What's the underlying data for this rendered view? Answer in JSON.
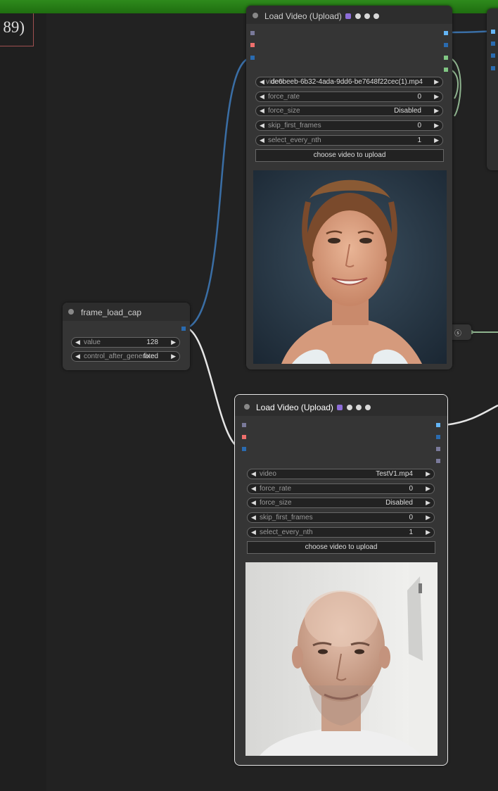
{
  "canvas": {
    "corner_label": "89)"
  },
  "colors": {
    "background": "#222222",
    "node_body": "#353535",
    "node_header": "#2d2d2d",
    "wire_blue": "#3a6ea5",
    "wire_white": "#e6e6e6",
    "wire_green": "#8fb48f",
    "port_image": "#64b5f6",
    "port_mask": "#81c784",
    "port_audio": "#ef6f6c",
    "port_int": "#2a6bb0",
    "port_meta": "#7a7a9a"
  },
  "frame_load_cap_node": {
    "title": "frame_load_cap",
    "widgets": [
      {
        "label": "value",
        "value": "128"
      },
      {
        "label": "control_after_generate",
        "value": "fixed"
      }
    ]
  },
  "load_video_top": {
    "title": "Load Video (Upload)",
    "badges": [
      "purple-badge-icon",
      "v-badge-icon",
      "h-badge-icon",
      "s-badge-icon"
    ],
    "widgets": [
      {
        "label": "video",
        "value": "de6beeb-6b32-4ada-9dd6-be7648f22cec(1).mp4"
      },
      {
        "label": "force_rate",
        "value": "0"
      },
      {
        "label": "force_size",
        "value": "Disabled"
      },
      {
        "label": "skip_first_frames",
        "value": "0"
      },
      {
        "label": "select_every_nth",
        "value": "1"
      }
    ],
    "upload_button": "choose video to upload",
    "preview_icon": "woman-portrait-preview"
  },
  "load_video_bottom": {
    "title": "Load Video (Upload)",
    "badges": [
      "purple-badge-icon",
      "v-badge-icon",
      "h-badge-icon",
      "s-badge-icon"
    ],
    "widgets": [
      {
        "label": "video",
        "value": "TestV1.mp4"
      },
      {
        "label": "force_rate",
        "value": "0"
      },
      {
        "label": "force_size",
        "value": "Disabled"
      },
      {
        "label": "skip_first_frames",
        "value": "0"
      },
      {
        "label": "select_every_nth",
        "value": "1"
      }
    ],
    "upload_button": "choose video to upload",
    "preview_icon": "man-portrait-preview"
  },
  "collapsed_node": {
    "badges": "ⓢ"
  }
}
